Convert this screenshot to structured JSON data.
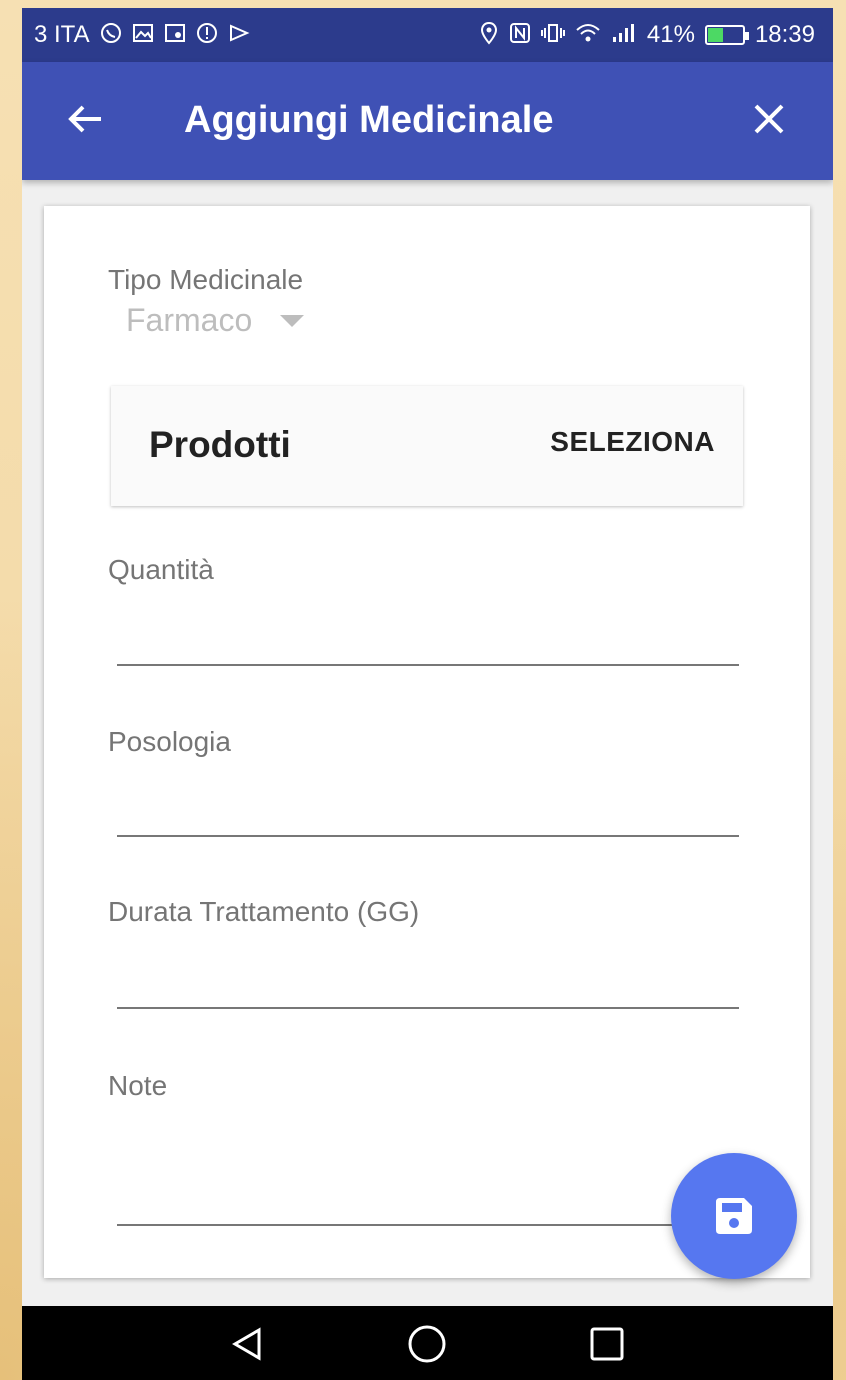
{
  "status_bar": {
    "carrier": "3 ITA",
    "battery_percent": "41%",
    "time": "18:39",
    "battery_level": 0.41,
    "left_icons": [
      "whatsapp-icon",
      "gallery-icon",
      "maps-icon",
      "alert-icon",
      "play-store-icon"
    ],
    "right_icons": [
      "location-icon",
      "nfc-icon",
      "vibrate-icon",
      "wifi-icon",
      "signal-icon"
    ]
  },
  "app_bar": {
    "title": "Aggiungi Medicinale",
    "color": "#3f51b5",
    "back_icon": "arrow-back-icon",
    "close_icon": "close-icon"
  },
  "form": {
    "tipo_medicinale": {
      "label": "Tipo Medicinale",
      "value": "Farmaco"
    },
    "prodotti": {
      "title": "Prodotti",
      "action": "SELEZIONA"
    },
    "quantita": {
      "label": "Quantità",
      "value": ""
    },
    "posologia": {
      "label": "Posologia",
      "value": ""
    },
    "durata": {
      "label": "Durata Trattamento (GG)",
      "value": ""
    },
    "note": {
      "label": "Note",
      "value": ""
    }
  },
  "fab": {
    "icon": "save-icon",
    "color": "#5677f0"
  },
  "nav_bar": {
    "back_icon": "nav-back-icon",
    "home_icon": "nav-home-icon",
    "recents_icon": "nav-recents-icon"
  }
}
